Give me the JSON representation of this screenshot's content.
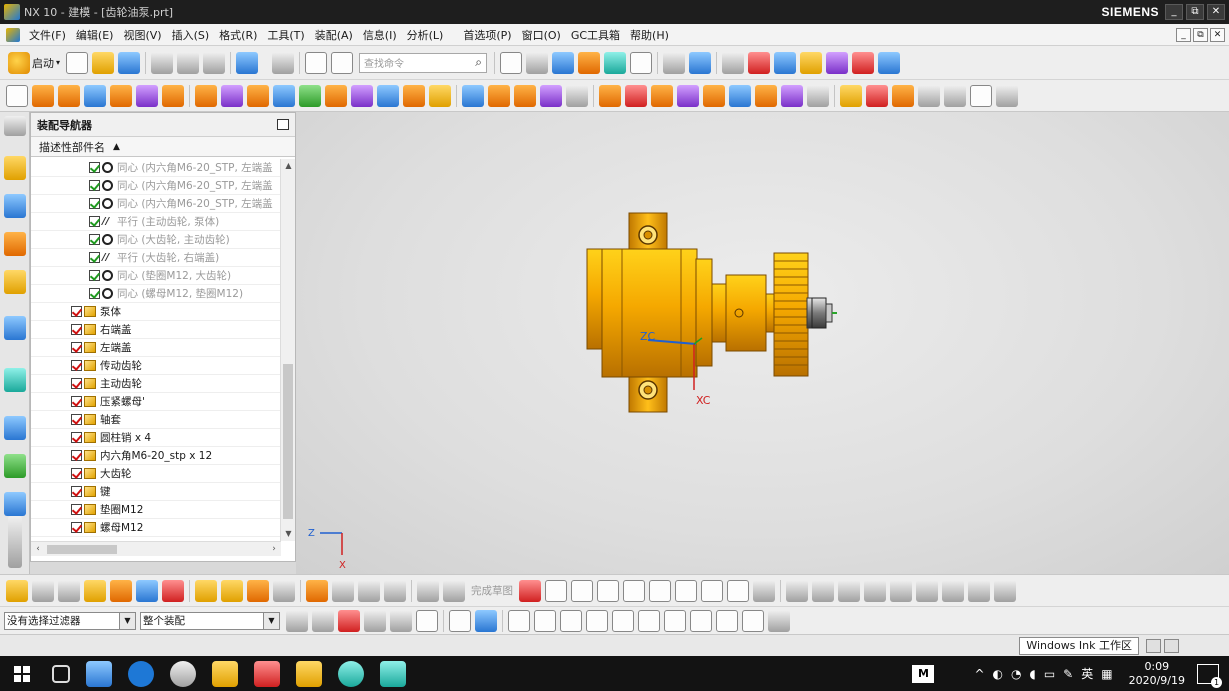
{
  "window": {
    "title": "NX 10 - 建模 - [齿轮油泵.prt]",
    "brand": "SIEMENS",
    "controls": [
      "_",
      "⧉",
      "✕"
    ]
  },
  "menu": {
    "items": [
      "文件(F)",
      "编辑(E)",
      "视图(V)",
      "插入(S)",
      "格式(R)",
      "工具(T)",
      "装配(A)",
      "信息(I)",
      "分析(L)",
      "首选项(P)",
      "窗口(O)",
      "GC工具箱",
      "帮助(H)"
    ],
    "mdi": [
      "_",
      "⧉",
      "✕"
    ]
  },
  "toolbar": {
    "start_label": "启动",
    "search_placeholder": "查找命令"
  },
  "navigator": {
    "title": "装配导航器",
    "column_header": "描述性部件名",
    "constraints": [
      {
        "type": "concentric",
        "label": "同心 (内六角M6-20_STP, 左端盖"
      },
      {
        "type": "concentric",
        "label": "同心 (内六角M6-20_STP, 左端盖"
      },
      {
        "type": "concentric",
        "label": "同心 (内六角M6-20_STP, 左端盖"
      },
      {
        "type": "parallel",
        "label": "平行 (主动齿轮, 泵体)"
      },
      {
        "type": "concentric",
        "label": "同心 (大齿轮, 主动齿轮)"
      },
      {
        "type": "parallel",
        "label": "平行 (大齿轮, 右端盖)"
      },
      {
        "type": "concentric",
        "label": "同心 (垫圈M12, 大齿轮)"
      },
      {
        "type": "concentric",
        "label": "同心 (螺母M12, 垫圈M12)"
      }
    ],
    "parts": [
      "泵体",
      "右端盖",
      "左端盖",
      "传动齿轮",
      "主动齿轮",
      "压紧螺母'",
      "轴套",
      "圆柱销 x 4",
      "内六角M6-20_stp x 12",
      "大齿轮",
      "键",
      "垫圈M12",
      "螺母M12"
    ]
  },
  "viewport": {
    "axis_zc": "ZC",
    "axis_xc": "XC",
    "triad_z": "Z",
    "triad_x": "X"
  },
  "bottom_toolbar": {
    "sketch_done_label": "完成草图",
    "filter_value": "没有选择过滤器",
    "scope_value": "整个装配"
  },
  "status": {
    "ink_workspace": "Windows Ink 工作区"
  },
  "taskbar": {
    "time": "0:09",
    "date": "2020/9/19",
    "ime": "英",
    "notification_count": "1",
    "m_label": "M"
  },
  "colors": {
    "part_gold": "#f0a800",
    "part_dark": "#b07000",
    "axis_red": "#d02020",
    "axis_blue": "#2060d0",
    "taskbar": "#131313"
  }
}
